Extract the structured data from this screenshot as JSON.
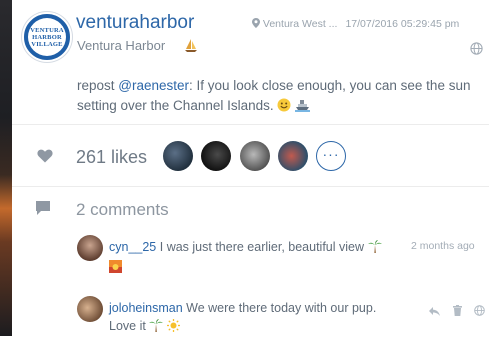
{
  "post": {
    "username": "venturaharbor",
    "location_name": "Ventura Harbor",
    "location_tag": "Ventura West ...",
    "timestamp": "17/07/2016 05:29:45 pm",
    "caption_prefix": "repost ",
    "mention": "@raenester",
    "caption_text": ": If you look close enough, you can see the sun setting over the Channel Islands."
  },
  "avatar_text": [
    "VENTURA",
    "HARBOR",
    "VILLAGE"
  ],
  "likes": {
    "label": "261 likes",
    "more_label": "···"
  },
  "comments": {
    "count_label": "2 comments",
    "items": [
      {
        "user": "cyn__25",
        "text": "I was just there earlier, beautiful view",
        "time": "2 months ago"
      },
      {
        "user": "joloheinsman",
        "text": "We were there today with our pup. Love it"
      }
    ]
  },
  "icons": [
    "location-pin-icon",
    "sailboat-icon",
    "globe-icon",
    "heart-icon",
    "comment-icon",
    "reply-icon",
    "trash-icon"
  ],
  "colors": {
    "accent": "#2d67a8",
    "text": "#5f6b78",
    "muted": "#9aa4ae"
  }
}
